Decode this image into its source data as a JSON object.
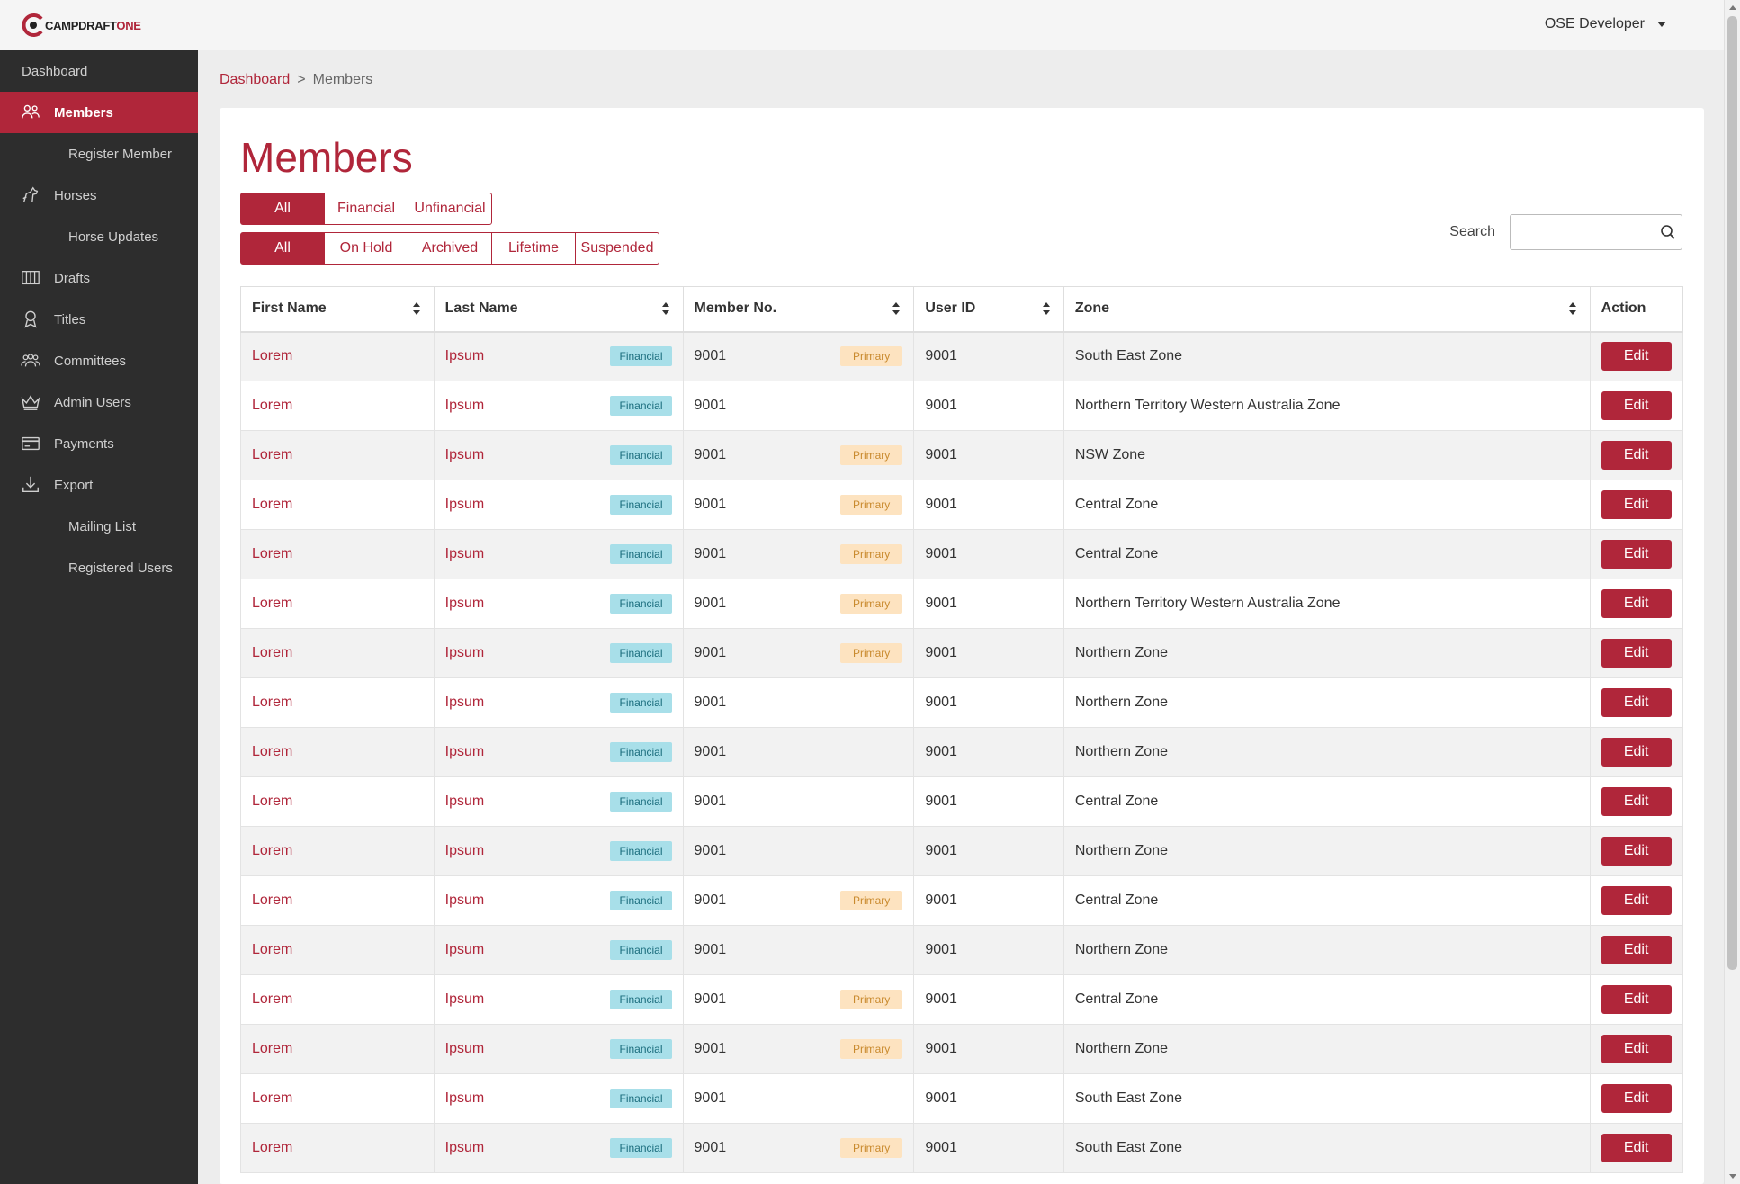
{
  "brand": {
    "prefix": "CAMPDRAFT",
    "suffix": "ONE",
    "color": "#b0263a"
  },
  "user": {
    "name": "OSE Developer"
  },
  "sidebar": {
    "items": [
      {
        "label": "Dashboard",
        "kind": "top",
        "icon": ""
      },
      {
        "label": "Members",
        "kind": "icon",
        "icon": "users-icon",
        "active": true
      },
      {
        "label": "Register Member",
        "kind": "sub",
        "icon": ""
      },
      {
        "label": "Horses",
        "kind": "icon",
        "icon": "horse-icon"
      },
      {
        "label": "Horse Updates",
        "kind": "sub",
        "icon": ""
      },
      {
        "label": "Drafts",
        "kind": "icon",
        "icon": "fence-icon"
      },
      {
        "label": "Titles",
        "kind": "icon",
        "icon": "award-icon"
      },
      {
        "label": "Committees",
        "kind": "icon",
        "icon": "group-icon"
      },
      {
        "label": "Admin Users",
        "kind": "icon",
        "icon": "crown-icon"
      },
      {
        "label": "Payments",
        "kind": "icon",
        "icon": "card-icon"
      },
      {
        "label": "Export",
        "kind": "icon",
        "icon": "download-icon"
      },
      {
        "label": "Mailing List",
        "kind": "sub",
        "icon": ""
      },
      {
        "label": "Registered Users",
        "kind": "sub",
        "icon": ""
      }
    ]
  },
  "breadcrumb": {
    "home": "Dashboard",
    "separator": ">",
    "current": "Members"
  },
  "page": {
    "title": "Members"
  },
  "filters": {
    "financial": [
      "All",
      "Financial",
      "Unfinancial"
    ],
    "status": [
      "All",
      "On Hold",
      "Archived",
      "Lifetime",
      "Suspended"
    ]
  },
  "search": {
    "label": "Search",
    "value": ""
  },
  "table": {
    "columns": [
      "First Name",
      "Last Name",
      "Member No.",
      "User ID",
      "Zone",
      "Action"
    ],
    "edit_label": "Edit",
    "rows": [
      {
        "first": "Lorem",
        "last": "Ipsum",
        "fin": "Financial",
        "memno": "9001",
        "primary": "Primary",
        "userid": "9001",
        "zone": "South East Zone"
      },
      {
        "first": "Lorem",
        "last": "Ipsum",
        "fin": "Financial",
        "memno": "9001",
        "primary": "",
        "userid": "9001",
        "zone": "Northern Territory Western Australia Zone"
      },
      {
        "first": "Lorem",
        "last": "Ipsum",
        "fin": "Financial",
        "memno": "9001",
        "primary": "Primary",
        "userid": "9001",
        "zone": "NSW Zone"
      },
      {
        "first": "Lorem",
        "last": "Ipsum",
        "fin": "Financial",
        "memno": "9001",
        "primary": "Primary",
        "userid": "9001",
        "zone": "Central Zone"
      },
      {
        "first": "Lorem",
        "last": "Ipsum",
        "fin": "Financial",
        "memno": "9001",
        "primary": "Primary",
        "userid": "9001",
        "zone": "Central Zone"
      },
      {
        "first": "Lorem",
        "last": "Ipsum",
        "fin": "Financial",
        "memno": "9001",
        "primary": "Primary",
        "userid": "9001",
        "zone": "Northern Territory Western Australia Zone"
      },
      {
        "first": "Lorem",
        "last": "Ipsum",
        "fin": "Financial",
        "memno": "9001",
        "primary": "Primary",
        "userid": "9001",
        "zone": "Northern Zone"
      },
      {
        "first": "Lorem",
        "last": "Ipsum",
        "fin": "Financial",
        "memno": "9001",
        "primary": "",
        "userid": "9001",
        "zone": "Northern Zone"
      },
      {
        "first": "Lorem",
        "last": "Ipsum",
        "fin": "Financial",
        "memno": "9001",
        "primary": "",
        "userid": "9001",
        "zone": "Northern Zone"
      },
      {
        "first": "Lorem",
        "last": "Ipsum",
        "fin": "Financial",
        "memno": "9001",
        "primary": "",
        "userid": "9001",
        "zone": "Central Zone"
      },
      {
        "first": "Lorem",
        "last": "Ipsum",
        "fin": "Financial",
        "memno": "9001",
        "primary": "",
        "userid": "9001",
        "zone": "Northern Zone"
      },
      {
        "first": "Lorem",
        "last": "Ipsum",
        "fin": "Financial",
        "memno": "9001",
        "primary": "Primary",
        "userid": "9001",
        "zone": "Central Zone"
      },
      {
        "first": "Lorem",
        "last": "Ipsum",
        "fin": "Financial",
        "memno": "9001",
        "primary": "",
        "userid": "9001",
        "zone": "Northern Zone"
      },
      {
        "first": "Lorem",
        "last": "Ipsum",
        "fin": "Financial",
        "memno": "9001",
        "primary": "Primary",
        "userid": "9001",
        "zone": "Central Zone"
      },
      {
        "first": "Lorem",
        "last": "Ipsum",
        "fin": "Financial",
        "memno": "9001",
        "primary": "Primary",
        "userid": "9001",
        "zone": "Northern Zone"
      },
      {
        "first": "Lorem",
        "last": "Ipsum",
        "fin": "Financial",
        "memno": "9001",
        "primary": "",
        "userid": "9001",
        "zone": "South East Zone"
      },
      {
        "first": "Lorem",
        "last": "Ipsum",
        "fin": "Financial",
        "memno": "9001",
        "primary": "Primary",
        "userid": "9001",
        "zone": "South East Zone"
      }
    ]
  }
}
